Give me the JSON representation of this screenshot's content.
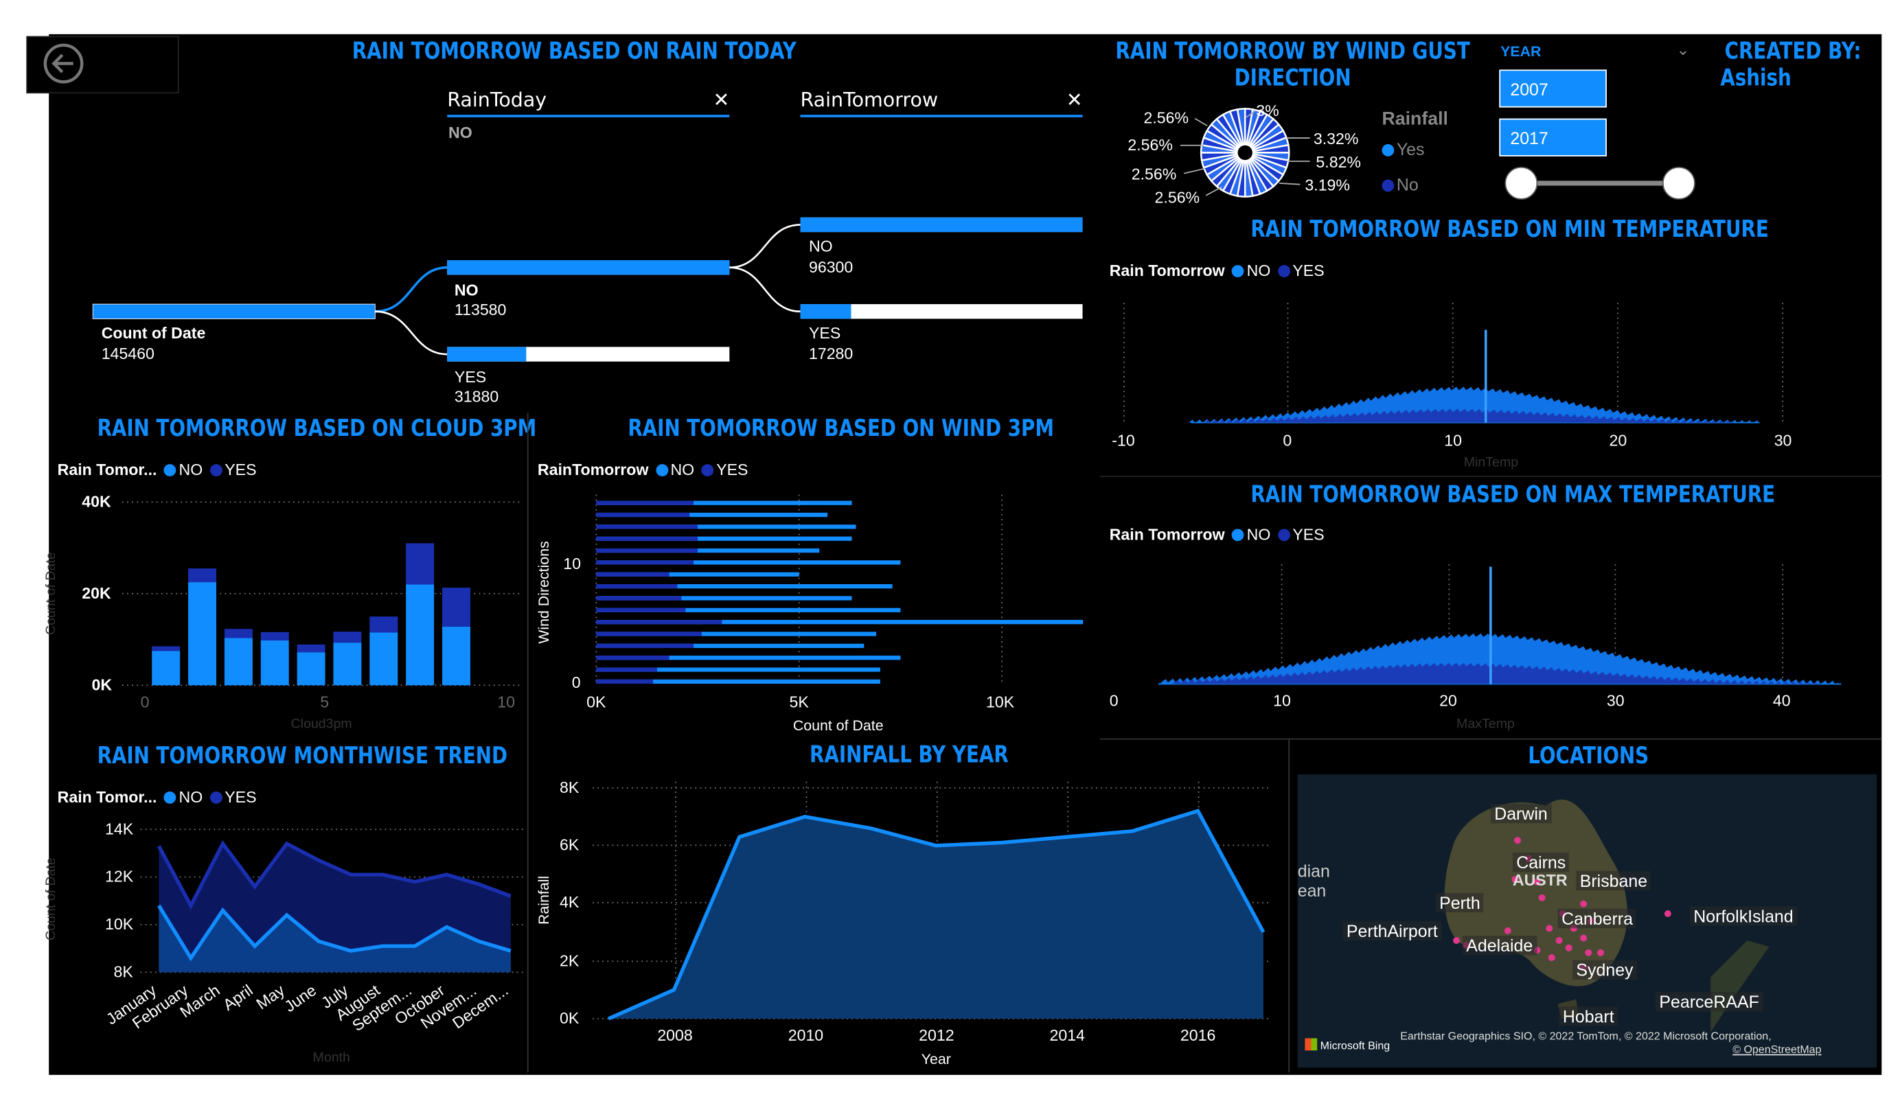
{
  "colors": {
    "accent": "#118dff",
    "no": "#118dff",
    "yes": "#1a2fb0",
    "background": "#000000"
  },
  "icons": {
    "back": "back-arrow-icon",
    "close": "close-icon",
    "dropdown": "chevron-down-icon"
  },
  "decomp": {
    "title": "RAIN TOMORROW BASED ON RAIN TODAY",
    "slicer1": "RainToday",
    "slicer1_value": "NO",
    "slicer2": "RainTomorrow",
    "root_label": "Count of Date",
    "root_value": "145460",
    "n1_label": "NO",
    "n1_value": "113580",
    "n2_label": "YES",
    "n2_value": "31880",
    "n3_label": "NO",
    "n3_value": "96300",
    "n4_label": "YES",
    "n4_value": "17280",
    "fractions": {
      "n1": 1,
      "n2": 0.28,
      "n3": 1,
      "n4": 0.18
    }
  },
  "wind_gust": {
    "title_line1": "RAIN TOMORROW BY WIND GUST",
    "title_line2": "DIRECTION",
    "legend_title": "Rainfall",
    "legend": [
      "Yes",
      "No"
    ],
    "labels_left": [
      "2.56%",
      "2.56%",
      "2.56%",
      "2.56%"
    ],
    "labels_right": [
      "3%",
      "3.32%",
      "5.82%",
      "3.19%"
    ]
  },
  "year_slicer": {
    "label": "YEAR",
    "from": "2007",
    "to": "2017"
  },
  "created_by": {
    "line1": "CREATED BY:",
    "line2": "Ashish"
  },
  "min_temp": {
    "title": "RAIN TOMORROW BASED ON MIN TEMPERATURE",
    "legend_title": "Rain Tomorrow",
    "legend": [
      "NO",
      "YES"
    ],
    "xticks": [
      "-10",
      "0",
      "10",
      "20",
      "30"
    ],
    "xlabel": "MinTemp"
  },
  "max_temp": {
    "title": "RAIN TOMORROW BASED ON MAX TEMPERATURE",
    "legend_title": "Rain Tomorrow",
    "legend": [
      "NO",
      "YES"
    ],
    "xticks": [
      "0",
      "10",
      "20",
      "30",
      "40"
    ],
    "xlabel": "MaxTemp"
  },
  "cloud": {
    "title": "RAIN TOMORROW BASED ON CLOUD 3PM",
    "legend_title": "Rain Tomor...",
    "legend": [
      "NO",
      "YES"
    ],
    "yticks": [
      "40K",
      "20K",
      "0K"
    ],
    "xticks": [
      "0",
      "5",
      "10"
    ],
    "ylabel": "Count of Date",
    "xlabel": "Cloud3pm"
  },
  "wind3pm": {
    "title": "RAIN TOMORROW BASED ON WIND 3PM",
    "legend_title": "RainTomorrow",
    "legend": [
      "NO",
      "YES"
    ],
    "yticks": [
      "10",
      "0"
    ],
    "xticks": [
      "0K",
      "5K",
      "10K"
    ],
    "ylabel": "Wind Directions",
    "xlabel": "Count of Date"
  },
  "month": {
    "title": "RAIN TOMORROW MONTHWISE TREND",
    "legend_title": "Rain Tomor...",
    "legend": [
      "NO",
      "YES"
    ],
    "yticks": [
      "14K",
      "12K",
      "10K",
      "8K"
    ],
    "ylabel": "Count of Date",
    "xlabel": "Month"
  },
  "rainfall": {
    "title": "RAINFALL BY YEAR",
    "yticks": [
      "8K",
      "6K",
      "4K",
      "2K",
      "0K"
    ],
    "xticks": [
      "2008",
      "2010",
      "2012",
      "2014",
      "2016"
    ],
    "ylabel": "Rainfall",
    "xlabel": "Year"
  },
  "locations": {
    "title": "LOCATIONS",
    "places": [
      "Darwin",
      "Cairns",
      "Brisbane",
      "Perth",
      "Canberra",
      "NorfolkIsland",
      "PerthAirport",
      "Adelaide",
      "Sydney",
      "PearceRAAF",
      "Hobart"
    ],
    "country": "AUSTR",
    "ocean": [
      "dian",
      "ean"
    ],
    "brand": "Microsoft Bing",
    "credits": "Earthstar Geographics SIO, © 2022 TomTom, © 2022 Microsoft Corporation,",
    "osm": "© OpenStreetMap"
  },
  "chart_data": [
    {
      "type": "bar",
      "title": "RAIN TOMORROW BASED ON CLOUD 3PM",
      "xlabel": "Cloud3pm",
      "ylabel": "Count of Date",
      "ylim": [
        0,
        40000
      ],
      "x": [
        0,
        1,
        2,
        3,
        4,
        5,
        6,
        7,
        8
      ],
      "series": [
        {
          "name": "NO",
          "values": [
            7500,
            22500,
            10300,
            9800,
            7200,
            9300,
            11500,
            22000,
            12800
          ]
        },
        {
          "name": "YES",
          "values": [
            1000,
            3000,
            2000,
            1800,
            1700,
            2400,
            3500,
            9000,
            8500
          ]
        }
      ]
    },
    {
      "type": "bar",
      "title": "RAIN TOMORROW BASED ON WIND 3PM",
      "xlabel": "Count of Date",
      "ylabel": "Wind Directions",
      "xlim": [
        0,
        12000
      ],
      "y": [
        0,
        1,
        2,
        3,
        4,
        5,
        6,
        7,
        8,
        9,
        10,
        11,
        12,
        13,
        14,
        15
      ],
      "series": [
        {
          "name": "NO",
          "values": [
            6300,
            5700,
            6400,
            6300,
            5500,
            7500,
            5000,
            7300,
            6300,
            7500,
            12000,
            6900,
            6600,
            7500,
            7000,
            7000
          ]
        },
        {
          "name": "YES",
          "values": [
            2400,
            2300,
            2500,
            2500,
            2500,
            2400,
            1800,
            2000,
            2100,
            2200,
            3100,
            2600,
            2400,
            1800,
            1500,
            1400
          ]
        }
      ]
    },
    {
      "type": "area",
      "title": "RAIN TOMORROW MONTHWISE TREND",
      "xlabel": "Month",
      "ylabel": "Count of Date",
      "ylim": [
        8000,
        14000
      ],
      "categories": [
        "January",
        "February",
        "March",
        "April",
        "May",
        "June",
        "July",
        "August",
        "Septem...",
        "October",
        "Novem...",
        "Decem..."
      ],
      "series": [
        {
          "name": "NO",
          "values": [
            10800,
            8600,
            10600,
            9100,
            10400,
            9300,
            8900,
            9100,
            9100,
            9900,
            9300,
            8900
          ]
        },
        {
          "name": "YES",
          "values": [
            13300,
            10800,
            13400,
            11600,
            13400,
            12700,
            12100,
            12100,
            11800,
            12100,
            11700,
            11200
          ]
        }
      ]
    },
    {
      "type": "area",
      "title": "RAINFALL BY YEAR",
      "xlabel": "Year",
      "ylabel": "Rainfall",
      "ylim": [
        0,
        8000
      ],
      "x": [
        2007,
        2008,
        2009,
        2010,
        2011,
        2012,
        2013,
        2014,
        2015,
        2016,
        2017
      ],
      "series": [
        {
          "name": "Rainfall",
          "values": [
            0,
            1000,
            6300,
            7000,
            6600,
            6000,
            6100,
            6300,
            6500,
            7200,
            3000
          ]
        }
      ]
    },
    {
      "type": "histogram",
      "title": "RAIN TOMORROW BASED ON MIN TEMPERATURE",
      "xlabel": "MinTemp",
      "xlim": [
        -10,
        30
      ],
      "series": [
        {
          "name": "NO"
        },
        {
          "name": "YES"
        }
      ]
    },
    {
      "type": "histogram",
      "title": "RAIN TOMORROW BASED ON MAX TEMPERATURE",
      "xlabel": "MaxTemp",
      "xlim": [
        0,
        45
      ],
      "series": [
        {
          "name": "NO"
        },
        {
          "name": "YES"
        }
      ]
    },
    {
      "type": "pie",
      "title": "RAIN TOMORROW BY WIND GUST DIRECTION",
      "legend": [
        "Yes",
        "No"
      ],
      "labeled_slices": [
        "3%",
        "3.32%",
        "5.82%",
        "3.19%",
        "2.56%",
        "2.56%",
        "2.56%",
        "2.56%"
      ]
    }
  ]
}
